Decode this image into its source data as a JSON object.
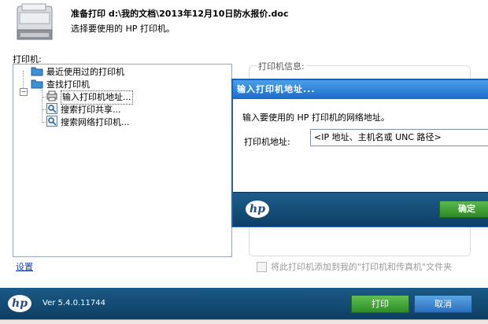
{
  "header": {
    "title": "准备打印 d:\\我的文档\\2013年12月10日防水报价.doc",
    "subtitle": "选择要使用的 HP 打印机。"
  },
  "printers_label": "打印机:",
  "tree": {
    "recent": "最近使用过的打印机",
    "find": "查找打印机",
    "items": [
      "输入打印机地址...",
      "搜索打印共享...",
      "搜索网络打印机..."
    ]
  },
  "settings_link": "设置",
  "info_label": "打印机信息:",
  "add_to_folder_label": "将此打印机添加到我的\"打印机和传真机\"文件夹",
  "dialog": {
    "title": "输入打印机地址...",
    "description": "输入要使用的 HP 打印机的网络地址。",
    "address_label": "打印机地址:",
    "address_value": "<IP 地址、主机名或 UNC 路径>",
    "ok_label": "确定"
  },
  "footer": {
    "version": "Ver 5.4.0.11744",
    "print_label": "打印",
    "cancel_label": "取消"
  },
  "logo_text": "hp"
}
